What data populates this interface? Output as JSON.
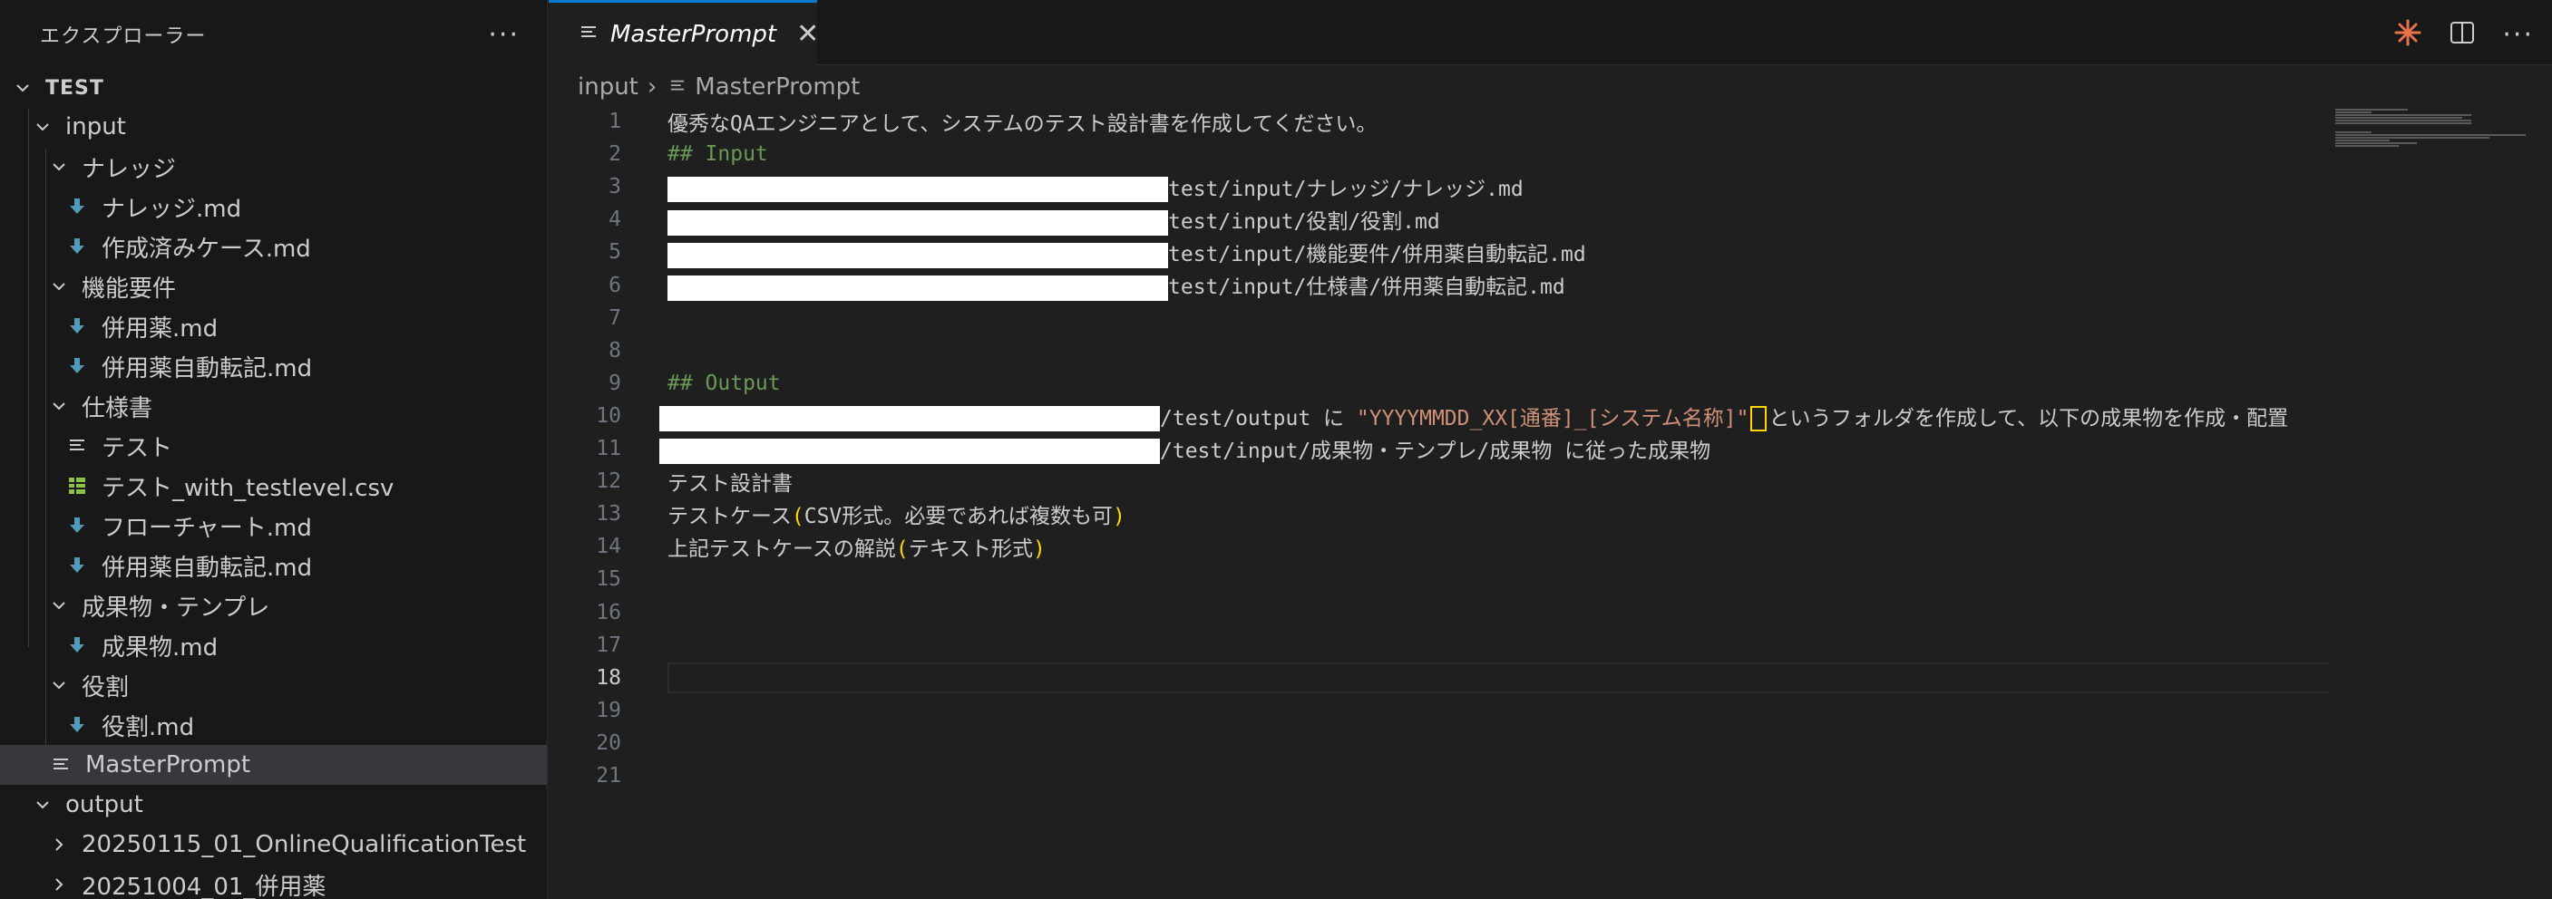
{
  "sidebar": {
    "title": "エクスプローラー",
    "root": "TEST",
    "items": [
      {
        "label": "input",
        "type": "folder",
        "depth": 1
      },
      {
        "label": "ナレッジ",
        "type": "folder",
        "depth": 2
      },
      {
        "label": "ナレッジ.md",
        "type": "md",
        "depth": 3
      },
      {
        "label": "作成済みケース.md",
        "type": "md",
        "depth": 3
      },
      {
        "label": "機能要件",
        "type": "folder",
        "depth": 2
      },
      {
        "label": "併用薬.md",
        "type": "md",
        "depth": 3
      },
      {
        "label": "併用薬自動転記.md",
        "type": "md",
        "depth": 3
      },
      {
        "label": "仕様書",
        "type": "folder",
        "depth": 2
      },
      {
        "label": "テスト",
        "type": "text",
        "depth": 3
      },
      {
        "label": "テスト_with_testlevel.csv",
        "type": "csv",
        "depth": 3
      },
      {
        "label": "フローチャート.md",
        "type": "md",
        "depth": 3
      },
      {
        "label": "併用薬自動転記.md",
        "type": "md",
        "depth": 3
      },
      {
        "label": "成果物・テンプレ",
        "type": "folder",
        "depth": 2
      },
      {
        "label": "成果物.md",
        "type": "md",
        "depth": 3
      },
      {
        "label": "役割",
        "type": "folder",
        "depth": 2
      },
      {
        "label": "役割.md",
        "type": "md",
        "depth": 3
      },
      {
        "label": "MasterPrompt",
        "type": "text",
        "depth": 2,
        "selected": true
      },
      {
        "label": "output",
        "type": "folder",
        "depth": 1
      },
      {
        "label": "20250115_01_OnlineQualificationTest",
        "type": "folder-collapsed",
        "depth": 2
      },
      {
        "label": "20251004_01_併用薬",
        "type": "folder-collapsed",
        "depth": 2
      }
    ]
  },
  "tab": {
    "label": "MasterPrompt"
  },
  "breadcrumb": {
    "folder": "input",
    "file": "MasterPrompt"
  },
  "editor": {
    "active_line": 18,
    "lines": [
      {
        "n": "1",
        "text": "優秀なQAエンジニアとして、システムのテスト設計書を作成してください。"
      },
      {
        "n": "2",
        "text": "## Input"
      },
      {
        "n": "3",
        "text": "test/input/ナレッジ/ナレッジ.md"
      },
      {
        "n": "4",
        "text": "test/input/役割/役割.md"
      },
      {
        "n": "5",
        "text": "test/input/機能要件/併用薬自動転記.md"
      },
      {
        "n": "6",
        "text": "test/input/仕様書/併用薬自動転記.md"
      },
      {
        "n": "7",
        "text": ""
      },
      {
        "n": "8",
        "text": ""
      },
      {
        "n": "9",
        "text": "## Output"
      },
      {
        "n": "10",
        "text_a": "/test/output に ",
        "text_str": "\"YYYYMMDD_XX[通番]_[システム名称]\"",
        "text_b": "というフォルダを作成して、以下の成果物を作成・配置"
      },
      {
        "n": "11",
        "text": "/test/input/成果物・テンプレ/成果物 に従った成果物"
      },
      {
        "n": "12",
        "text": "テスト設計書"
      },
      {
        "n": "13",
        "text_a": "テストケース",
        "p1": "(",
        "text_mid": "CSV形式。必要であれば複数も可",
        "p2": ")"
      },
      {
        "n": "14",
        "text_a": "上記テストケースの解説",
        "p1": "(",
        "text_mid": "テキスト形式",
        "p2": ")"
      },
      {
        "n": "15",
        "text": ""
      },
      {
        "n": "16",
        "text": ""
      },
      {
        "n": "17",
        "text": ""
      },
      {
        "n": "18",
        "text": ""
      },
      {
        "n": "19",
        "text": ""
      },
      {
        "n": "20",
        "text": ""
      },
      {
        "n": "21",
        "text": ""
      }
    ]
  },
  "colors": {
    "accent": "#0078d4",
    "heading": "#6a9955",
    "string": "#ce9178",
    "paren": "#ffd700",
    "md_icon": "#519aba",
    "csv_icon": "#8dc149",
    "spark": "#e8734a"
  },
  "icons": [
    "more-icon",
    "chevron-down-icon",
    "chevron-right-icon",
    "markdown-icon",
    "text-file-icon",
    "csv-icon",
    "close-icon",
    "spark-icon",
    "split-editor-icon"
  ]
}
